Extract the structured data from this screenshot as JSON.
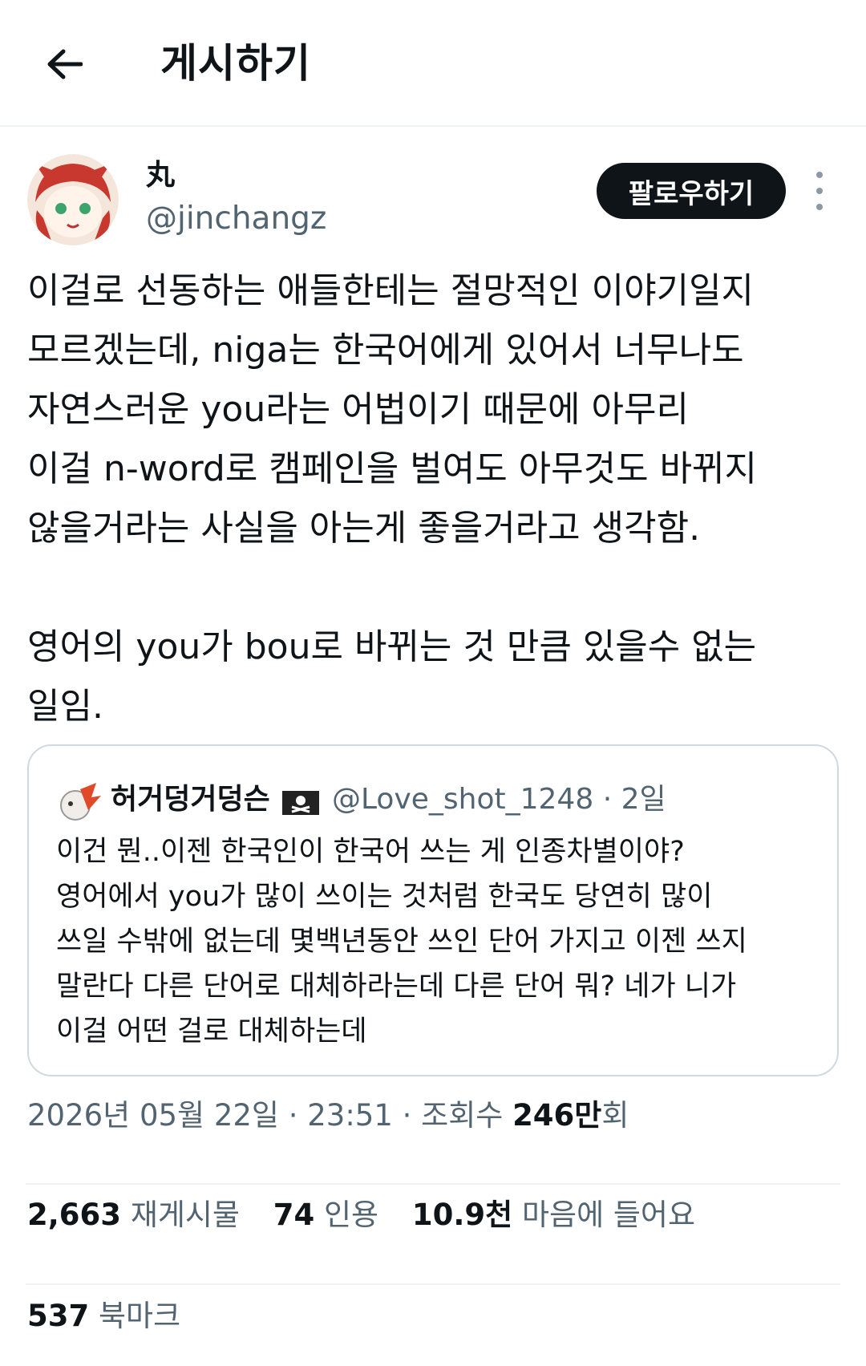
{
  "header": {
    "back_icon": "arrow-left-icon",
    "title": "게시하기"
  },
  "author": {
    "display_name": "丸",
    "handle": "@jinchangz",
    "avatar_icon": "anime-avatar"
  },
  "follow_button": "팔로우하기",
  "more_icon": "vertical-ellipsis-icon",
  "tweet": {
    "text": "이걸로 선동하는 애들한테는 절망적인 이야기일지\n모르겠는데, niga는 한국어에게 있어서 너무나도\n자연스러운 you라는 어법이기 때문에 아무리\n이걸 n-word로 캠페인을 벌여도 아무것도 바뀌지\n않을거라는 사실을 아는게 좋을거라고 생각함.\n\n영어의 you가 bou로 바뀌는 것 만큼 있을수 없는\n일임."
  },
  "quote": {
    "name": "허거덩거덩슨",
    "flag_icon": "pirate-flag-icon",
    "handle": "@Love_shot_1248",
    "time": "· 2일",
    "text": "이건 뭔..이젠 한국인이 한국어 쓰는 게 인종차별이야?\n영어에서 you가 많이 쓰이는 것처럼 한국도 당연히 많이\n쓰일 수밖에 없는데 몇백년동안 쓰인 단어 가지고 이젠 쓰지\n말란다 다른 단어로 대체하라는데 다른 단어 뭐? 네가 니가\n이걸 어떤 걸로 대체하는데"
  },
  "meta": {
    "datetime": "2026년 05월 22일 · 23:51 · 조회수",
    "views_number": "246만",
    "views_suffix": "회"
  },
  "stats": {
    "reposts_count": "2,663",
    "reposts_label": "재게시물",
    "quotes_count": "74",
    "quotes_label": "인용",
    "likes_count": "10.9천",
    "likes_label": "마음에 들어요",
    "bookmarks_count": "537",
    "bookmarks_label": "북마크"
  },
  "colors": {
    "text_primary": "#0f1419",
    "text_secondary": "#536471",
    "border": "#cfd9de",
    "divider": "#eff3f4",
    "follow_bg": "#0f1419"
  }
}
